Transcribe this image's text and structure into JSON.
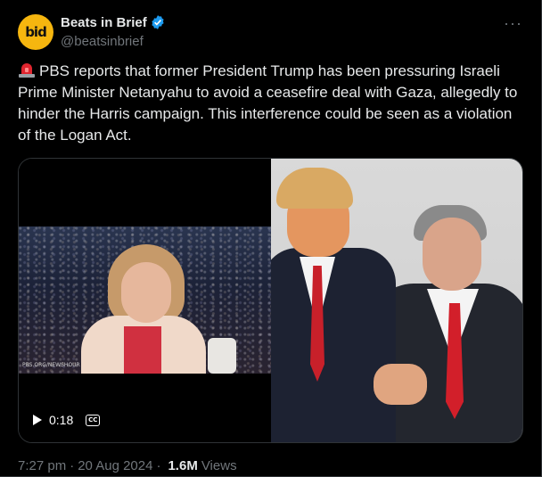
{
  "tweet": {
    "author": {
      "display_name": "Beats in Brief",
      "handle": "@beatsinbrief",
      "avatar_text": "bid",
      "verified": true
    },
    "text": "PBS reports that former President Trump has been pressuring Israeli Prime Minister Netanyahu to avoid a ceasefire deal with Gaza, allegedly to hinder the Harris campaign. This interference could be seen as a violation of the Logan Act.",
    "media": {
      "video_time": "0:18",
      "cc_label": "CC",
      "watermark": "PBS.ORG/NEWSHOUR"
    },
    "footer": {
      "time": "7:27 pm",
      "date": "20 Aug 2024",
      "views_count": "1.6M",
      "views_label": "Views"
    }
  },
  "icons": {
    "more": "more-icon",
    "siren": "siren-icon",
    "verified": "verified-badge-icon",
    "play": "play-icon",
    "cc": "closed-captions-icon"
  },
  "colors": {
    "background": "#000000",
    "text": "#e7e9ea",
    "secondary": "#71767b",
    "verified": "#1d9bf0",
    "avatar": "#f6b60f"
  }
}
